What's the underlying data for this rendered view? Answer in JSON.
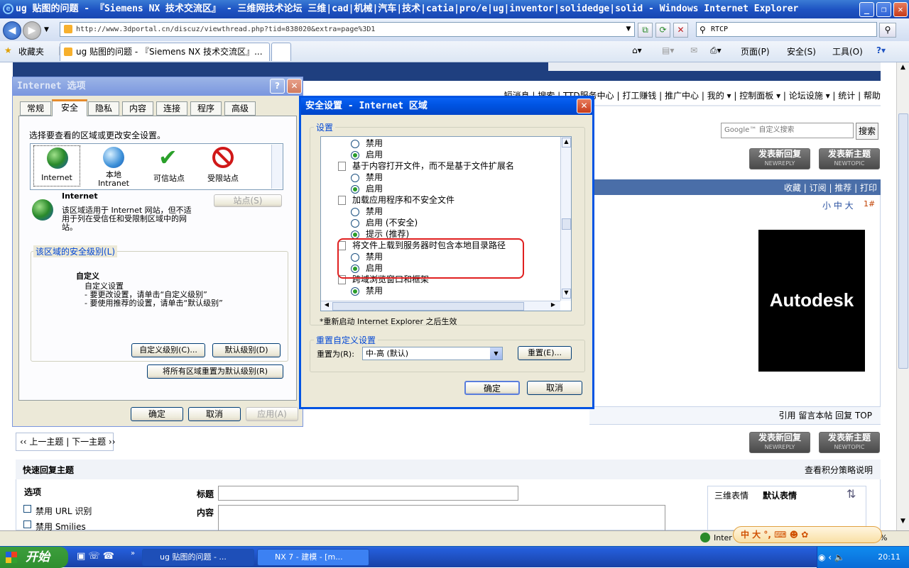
{
  "window": {
    "title": "ug 贴图的问题 - 『Siemens NX 技术交流区』 - 三维网技术论坛 三维|cad|机械|汽车|技术|catia|pro/e|ug|inventor|solidedge|solid - Windows Internet Explorer"
  },
  "address": {
    "url": "http://www.3dportal.cn/discuz/viewthread.php?tid=838020&extra=page%3D1",
    "search": "RTCP"
  },
  "favbar": {
    "favorites": "收藏夹",
    "tab_title": "ug 贴图的问题 - 『Siemens NX 技术交流区』...",
    "page_menu": "页面(P)",
    "safety_menu": "安全(S)",
    "tools_menu": "工具(O)"
  },
  "forum": {
    "nav": [
      "短消息",
      "搜索",
      "TTD服务中心",
      "打工赚钱",
      "推广中心",
      "我的",
      "控制面板",
      "论坛设施",
      "统计",
      "帮助"
    ],
    "google_placeholder": "Google™ 自定义搜索",
    "search_btn": "搜索",
    "reply_btn": "发表新回复",
    "reply_sub": "NEWREPLY",
    "topic_btn": "发表新主题",
    "topic_sub": "NEWTOPIC",
    "thread_actions": [
      "收藏",
      "订阅",
      "推荐",
      "打印"
    ],
    "font_size": "小 中 大",
    "floor": "1#",
    "ad_text": "Autodesk",
    "post_actions": "引用 留言本帖 回复 TOP",
    "prev_next": "‹‹ 上一主题 | 下一主题 ››",
    "quick_reply": "快速回复主题",
    "points_policy": "查看积分策略说明",
    "options": "选项",
    "disable_url": "禁用 URL 识别",
    "disable_smilies": "禁用 Smilies",
    "label_title": "标题",
    "label_content": "内容",
    "emoticon_tabs": [
      "三维表情",
      "默认表情"
    ]
  },
  "inetopts": {
    "title": "Internet 选项",
    "tabs": [
      "常规",
      "安全",
      "隐私",
      "内容",
      "连接",
      "程序",
      "高级"
    ],
    "select_zone": "选择要查看的区域或更改安全设置。",
    "zones": [
      {
        "name": "Internet",
        "icon": "globe-icon"
      },
      {
        "name": "本地\nIntranet",
        "icon": "intranet-icon"
      },
      {
        "name": "可信站点",
        "icon": "checkmark-icon"
      },
      {
        "name": "受限站点",
        "icon": "restricted-icon"
      }
    ],
    "zone_heading": "Internet",
    "zone_desc": "该区域适用于 Internet 网站，但不适用于列在受信任和受限制区域中的网站。",
    "sites_btn": "站点(S)",
    "level_group": "该区域的安全级别(L)",
    "custom": "自定义",
    "custom_desc1": "自定义设置",
    "custom_desc2": "- 要更改设置，请单击“自定义级别”",
    "custom_desc3": "- 要使用推荐的设置，请单击“默认级别”",
    "custom_level_btn": "自定义级别(C)...",
    "default_level_btn": "默认级别(D)",
    "reset_all_btn": "将所有区域重置为默认级别(R)",
    "ok": "确定",
    "cancel": "取消",
    "apply": "应用(A)"
  },
  "secdlg": {
    "title": "安全设置 - Internet 区域",
    "settings_group": "设置",
    "items": [
      {
        "type": "radio",
        "label": "禁用",
        "on": false
      },
      {
        "type": "radio",
        "label": "启用",
        "on": true
      },
      {
        "type": "head",
        "label": "基于内容打开文件，而不是基于文件扩展名"
      },
      {
        "type": "radio",
        "label": "禁用",
        "on": false
      },
      {
        "type": "radio",
        "label": "启用",
        "on": true
      },
      {
        "type": "head",
        "label": "加载应用程序和不安全文件"
      },
      {
        "type": "radio",
        "label": "禁用",
        "on": false
      },
      {
        "type": "radio",
        "label": "启用 (不安全)",
        "on": false
      },
      {
        "type": "radio",
        "label": "提示 (推荐)",
        "on": true
      },
      {
        "type": "head",
        "label": "将文件上载到服务器时包含本地目录路径"
      },
      {
        "type": "radio",
        "label": "禁用",
        "on": false
      },
      {
        "type": "radio",
        "label": "启用",
        "on": true
      },
      {
        "type": "head",
        "label": "跨域浏览窗口和框架"
      },
      {
        "type": "radio",
        "label": "禁用",
        "on": true
      }
    ],
    "restart_note": "*重新启动 Internet Explorer 之后生效",
    "reset_group": "重置自定义设置",
    "reset_to": "重置为(R):",
    "reset_value": "中-高 (默认)",
    "reset_btn": "重置(E)...",
    "ok": "确定",
    "cancel": "取消"
  },
  "statusbar": {
    "zone": "Inter",
    "zoom": "100%"
  },
  "ime": "中 大 °, ",
  "taskbar": {
    "start": "开始",
    "tasks": [
      "ug 贴图的问题 - ...",
      "NX 7 - 建模 - [m..."
    ],
    "clock": "20:11"
  }
}
